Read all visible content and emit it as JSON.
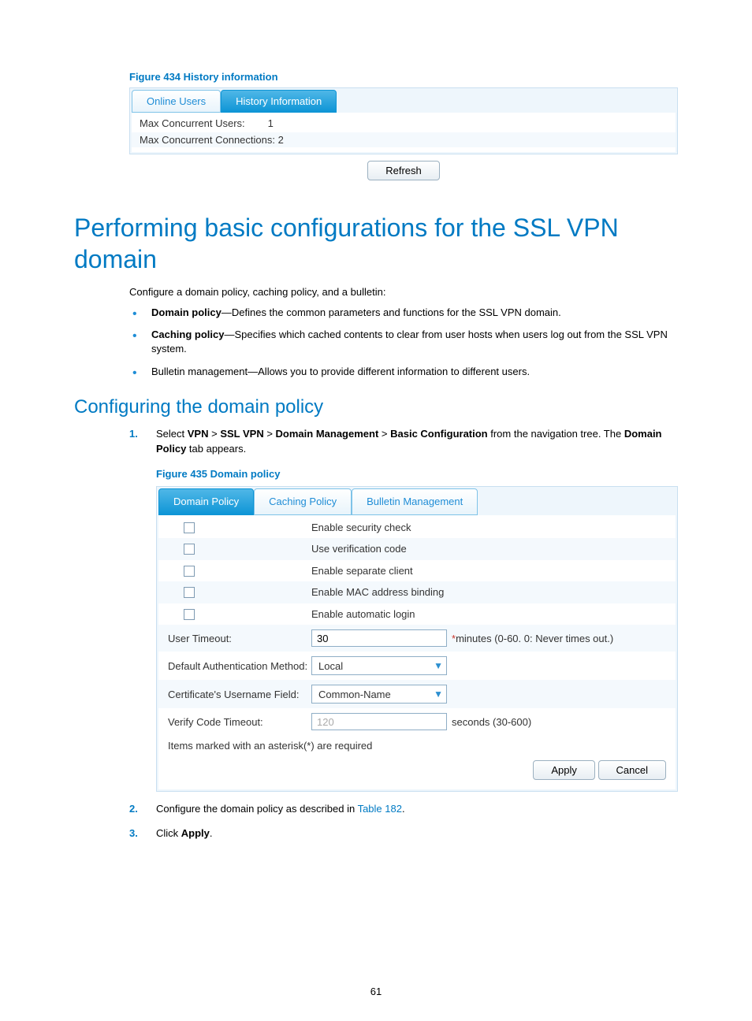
{
  "figure434": {
    "caption": "Figure 434 History information",
    "tabs": {
      "online": "Online Users",
      "history": "History Information"
    },
    "rows": {
      "maxUsersLabel": "Max Concurrent Users:",
      "maxUsersValue": "1",
      "maxConnLabel": "Max Concurrent Connections:",
      "maxConnValue": "2"
    },
    "refresh": "Refresh"
  },
  "section": {
    "h1": "Performing basic configurations for the SSL VPN domain",
    "intro": "Configure a domain policy, caching policy, and a bulletin:",
    "bullets": {
      "b1_strong": "Domain policy",
      "b1_rest": "—Defines the common parameters and functions for the SSL VPN domain.",
      "b2_strong": "Caching policy",
      "b2_rest": "—Specifies which cached contents to clear from user hosts when users log out from the SSL VPN system.",
      "b3": "Bulletin management—Allows you to provide different information to different users."
    },
    "h2": "Configuring the domain policy"
  },
  "steps": {
    "s1_pre": "Select ",
    "s1_b1": "VPN",
    "s1_gt": " > ",
    "s1_b2": "SSL VPN",
    "s1_b3": "Domain Management",
    "s1_b4": "Basic Configuration",
    "s1_post1": " from the navigation tree. The ",
    "s1_b5": "Domain Policy",
    "s1_post2": " tab appears.",
    "s2_pre": "Configure the domain policy as described in ",
    "s2_link": "Table 182",
    "s2_post": ".",
    "s3_pre": "Click ",
    "s3_b": "Apply",
    "s3_post": "."
  },
  "figure435": {
    "caption": "Figure 435 Domain policy",
    "tabs": {
      "domain": "Domain Policy",
      "caching": "Caching Policy",
      "bulletin": "Bulletin Management"
    },
    "checks": {
      "c1": "Enable security check",
      "c2": "Use verification code",
      "c3": "Enable separate client",
      "c4": "Enable MAC address binding",
      "c5": "Enable automatic login"
    },
    "fields": {
      "userTimeoutLabel": "User Timeout:",
      "userTimeoutValue": "30",
      "userTimeoutHint": "minutes (0-60. 0: Never times out.)",
      "authLabel": "Default Authentication Method:",
      "authValue": "Local",
      "certLabel": "Certificate's Username Field:",
      "certValue": "Common-Name",
      "verifyLabel": "Verify Code Timeout:",
      "verifyValue": "120",
      "verifyHint": "seconds (30-600)"
    },
    "footnote": "Items marked with an asterisk(*) are required",
    "apply": "Apply",
    "cancel": "Cancel"
  },
  "pageNumber": "61"
}
